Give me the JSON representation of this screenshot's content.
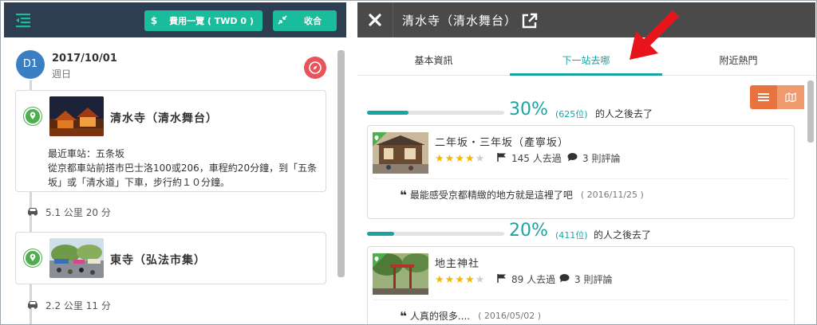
{
  "left_panel": {
    "cost_button": {
      "icon": "dollar-icon",
      "label": "費用一覽 ( TWD 0 )"
    },
    "collapse_button": {
      "icon": "compress-icon",
      "label": "收合"
    },
    "day": {
      "badge": "D1",
      "date": "2017/10/01",
      "weekday": "週日"
    },
    "spots": [
      {
        "name": "清水寺（清水舞台）",
        "desc": "最近車站：五条坂\n從京都車站前搭市巴士洛100或206，車程約20分鐘，到「五条坂」或「清水道」下車，步行約１０分鐘。"
      },
      {
        "name": "東寺（弘法市集）"
      }
    ],
    "travel": [
      {
        "mode": "car-icon",
        "distance": "5.1 公里",
        "duration": "20 分"
      },
      {
        "mode": "car-icon",
        "distance": "2.2 公里",
        "duration": "11 分"
      }
    ]
  },
  "right_panel": {
    "title": "清水寺（清水舞台）",
    "tabs": [
      {
        "label": "基本資訊",
        "active": false
      },
      {
        "label": "下一站去哪",
        "active": true
      },
      {
        "label": "附近熱門",
        "active": false
      }
    ],
    "next_spots": [
      {
        "percent_value": 30,
        "percent": "30%",
        "count": "(625位)",
        "suffix": "的人之後去了",
        "name": "二年坂・三年坂（產寧坂）",
        "rating": 4,
        "visits": "145 人去過",
        "reviews": "3 則評論",
        "quote": "最能感受京都精緻的地方就是這裡了吧",
        "quote_date": "( 2016/11/25 )"
      },
      {
        "percent_value": 20,
        "percent": "20%",
        "count": "(411位)",
        "suffix": "的人之後去了",
        "name": "地主神社",
        "rating": 4,
        "visits": "89 人去過",
        "reviews": "3 則評論",
        "quote": "人真的很多....",
        "quote_date": "( 2016/05/02 )"
      }
    ]
  },
  "colors": {
    "teal": "#1aa3a3",
    "button_teal": "#1abc9c",
    "navy": "#2c3e50",
    "dark_bar": "#4a4a4a",
    "orange": "#e8733e",
    "pin_green": "#4cae4c",
    "day_blue": "#3a7fc2",
    "compass_red": "#e8545a",
    "star": "#f5b800",
    "arrow_red": "#e8141c"
  }
}
